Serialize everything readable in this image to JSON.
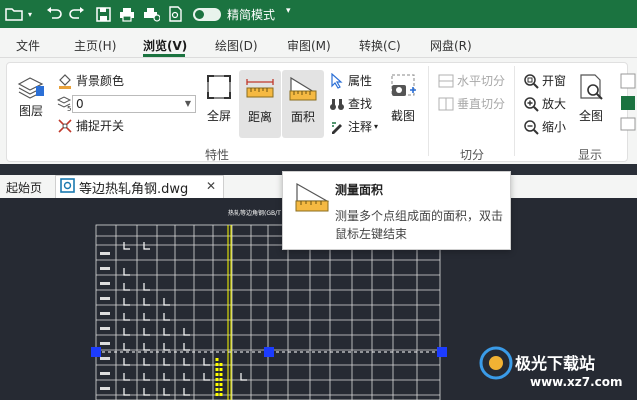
{
  "titlebar": {
    "toggle_label": "精简模式"
  },
  "menu": {
    "tabs": [
      "文件",
      "主页(H)",
      "浏览(V)",
      "绘图(D)",
      "审图(M)",
      "转换(C)",
      "网盘(R)"
    ],
    "active_tab": "浏览(V)"
  },
  "ribbon": {
    "layer": "图层",
    "bg_color": "背景颜色",
    "layer_value": "0",
    "snap": "捕捉开关",
    "fullscreen": "全屏",
    "distance": "距离",
    "area": "面积",
    "properties": "属性",
    "find": "查找",
    "annotate": "注释",
    "screenshot": "截图",
    "group_features": "特性",
    "h_split": "水平切分",
    "v_split": "垂直切分",
    "group_split": "切分",
    "open_window": "开窗",
    "zoom_in": "放大",
    "zoom_out": "缩小",
    "fit_all": "全图",
    "group_display": "显示"
  },
  "doc": {
    "start_tab": "起始页",
    "file_tab": "等边热轧角钢.dwg"
  },
  "tooltip": {
    "title": "测量面积",
    "desc": "测量多个点组成面的面积，双击鼠标左键结束"
  },
  "drawing": {
    "title": "热轧等边角钢(GB/T 706-2008)"
  },
  "watermark": {
    "text": "极光下载站",
    "url": "www.xz7.com"
  },
  "colors": {
    "brand": "#1b7340",
    "canvas": "#262a33",
    "grip": "#1c3cff",
    "highlight": "#ffff00"
  }
}
